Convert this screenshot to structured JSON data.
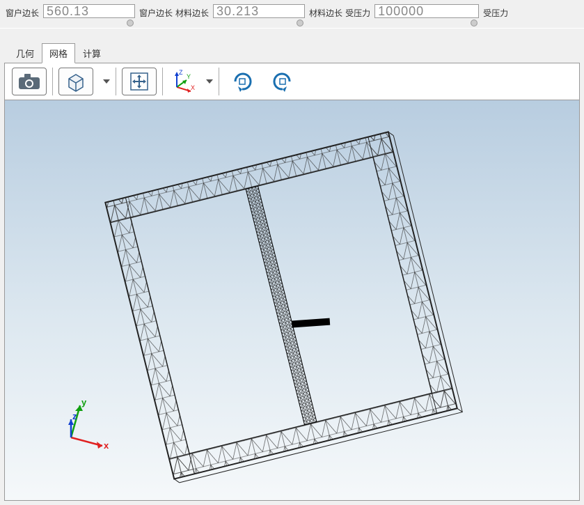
{
  "params": {
    "window_side": {
      "label_left": "窗户边长",
      "value": "560.13",
      "label_right": "窗户边长"
    },
    "material_side": {
      "label_left": "材料边长",
      "value": "30.213",
      "label_right": "材料边长"
    },
    "pressure": {
      "label_left": "受压力",
      "value": "100000",
      "label_right": "受压力"
    }
  },
  "tabs": {
    "geometry": "几何",
    "mesh": "网格",
    "compute": "计算"
  },
  "toolbar": {
    "camera": "camera-icon",
    "cube": "cube-icon",
    "move": "move-icon",
    "axes": "axes-icon",
    "rotate_cw": "rotate-cw-icon",
    "rotate_ccw": "rotate-ccw-icon"
  },
  "axes_hud": {
    "x": "x",
    "y": "y",
    "z": "z"
  },
  "toolbar_axes": {
    "x": "X",
    "y": "Y",
    "z": "Z"
  }
}
